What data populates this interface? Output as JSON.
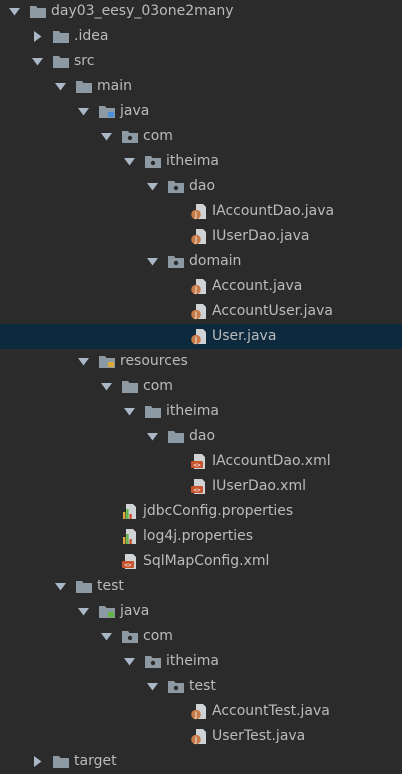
{
  "theme": {
    "background": "#2b2b2b",
    "text": "#bbbbbb",
    "selection": "#0d293e",
    "folder": "#8e9aa3",
    "java_badge": "#c57a48",
    "xml_badge": "#c9552e",
    "props_badge": "#d9a93b"
  },
  "project_tree": {
    "items": [
      {
        "label": "day03_eesy_03one2many",
        "depth": 0,
        "icon": "folder-icon",
        "arrow": "expanded",
        "selected": false
      },
      {
        "label": ".idea",
        "depth": 1,
        "icon": "folder-icon",
        "arrow": "collapsed",
        "selected": false
      },
      {
        "label": "src",
        "depth": 1,
        "icon": "folder-icon",
        "arrow": "expanded",
        "selected": false
      },
      {
        "label": "main",
        "depth": 2,
        "icon": "folder-icon",
        "arrow": "expanded",
        "selected": false
      },
      {
        "label": "java",
        "depth": 3,
        "icon": "source-folder-icon",
        "arrow": "expanded",
        "selected": false
      },
      {
        "label": "com",
        "depth": 4,
        "icon": "package-icon",
        "arrow": "expanded",
        "selected": false
      },
      {
        "label": "itheima",
        "depth": 5,
        "icon": "package-icon",
        "arrow": "expanded",
        "selected": false
      },
      {
        "label": "dao",
        "depth": 6,
        "icon": "package-icon",
        "arrow": "expanded",
        "selected": false
      },
      {
        "label": "IAccountDao.java",
        "depth": 7,
        "icon": "java-file-icon",
        "arrow": "none",
        "selected": false
      },
      {
        "label": "IUserDao.java",
        "depth": 7,
        "icon": "java-file-icon",
        "arrow": "none",
        "selected": false
      },
      {
        "label": "domain",
        "depth": 6,
        "icon": "package-icon",
        "arrow": "expanded",
        "selected": false
      },
      {
        "label": "Account.java",
        "depth": 7,
        "icon": "java-file-icon",
        "arrow": "none",
        "selected": false
      },
      {
        "label": "AccountUser.java",
        "depth": 7,
        "icon": "java-file-icon",
        "arrow": "none",
        "selected": false
      },
      {
        "label": "User.java",
        "depth": 7,
        "icon": "java-file-icon",
        "arrow": "none",
        "selected": true
      },
      {
        "label": "resources",
        "depth": 3,
        "icon": "resources-folder-icon",
        "arrow": "expanded",
        "selected": false
      },
      {
        "label": "com",
        "depth": 4,
        "icon": "folder-icon",
        "arrow": "expanded",
        "selected": false
      },
      {
        "label": "itheima",
        "depth": 5,
        "icon": "folder-icon",
        "arrow": "expanded",
        "selected": false
      },
      {
        "label": "dao",
        "depth": 6,
        "icon": "folder-icon",
        "arrow": "expanded",
        "selected": false
      },
      {
        "label": "IAccountDao.xml",
        "depth": 7,
        "icon": "xml-file-icon",
        "arrow": "none",
        "selected": false
      },
      {
        "label": "IUserDao.xml",
        "depth": 7,
        "icon": "xml-file-icon",
        "arrow": "none",
        "selected": false
      },
      {
        "label": "jdbcConfig.properties",
        "depth": 4,
        "icon": "properties-file-icon",
        "arrow": "none",
        "selected": false
      },
      {
        "label": "log4j.properties",
        "depth": 4,
        "icon": "properties-file-icon",
        "arrow": "none",
        "selected": false
      },
      {
        "label": "SqlMapConfig.xml",
        "depth": 4,
        "icon": "xml-file-icon",
        "arrow": "none",
        "selected": false
      },
      {
        "label": "test",
        "depth": 2,
        "icon": "folder-icon",
        "arrow": "expanded",
        "selected": false
      },
      {
        "label": "java",
        "depth": 3,
        "icon": "test-folder-icon",
        "arrow": "expanded",
        "selected": false
      },
      {
        "label": "com",
        "depth": 4,
        "icon": "package-icon",
        "arrow": "expanded",
        "selected": false
      },
      {
        "label": "itheima",
        "depth": 5,
        "icon": "package-icon",
        "arrow": "expanded",
        "selected": false
      },
      {
        "label": "test",
        "depth": 6,
        "icon": "package-icon",
        "arrow": "expanded",
        "selected": false
      },
      {
        "label": "AccountTest.java",
        "depth": 7,
        "icon": "java-file-icon",
        "arrow": "none",
        "selected": false
      },
      {
        "label": "UserTest.java",
        "depth": 7,
        "icon": "java-file-icon",
        "arrow": "none",
        "selected": false
      },
      {
        "label": "target",
        "depth": 1,
        "icon": "folder-icon",
        "arrow": "collapsed",
        "selected": false
      }
    ]
  }
}
